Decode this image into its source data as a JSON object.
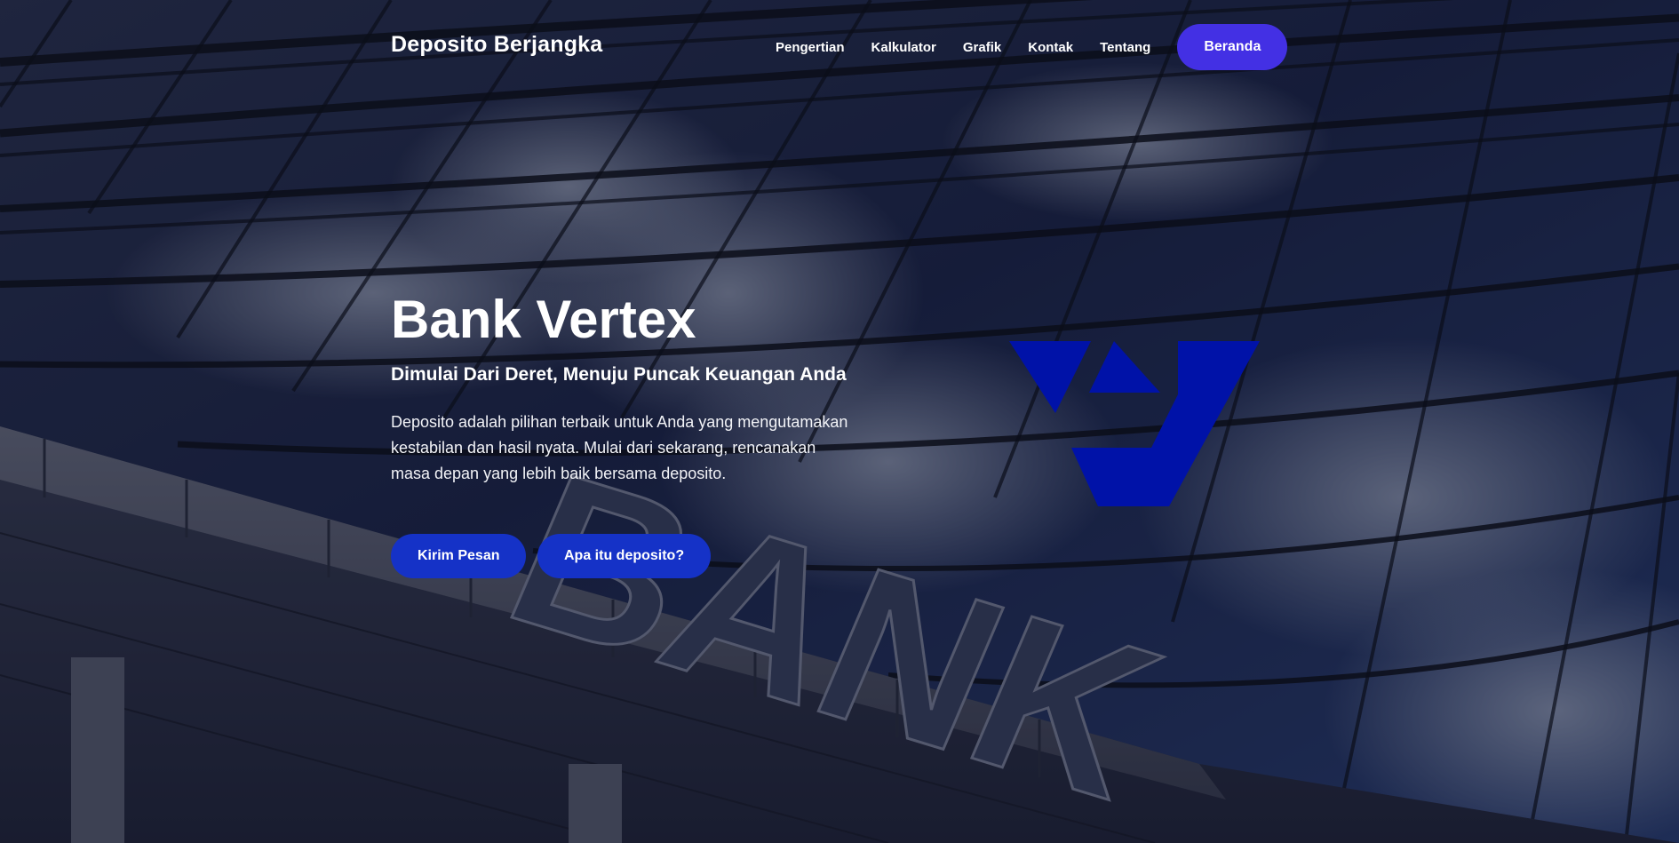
{
  "header": {
    "brand": "Deposito Berjangka",
    "nav": [
      {
        "label": "Pengertian"
      },
      {
        "label": "Kalkulator"
      },
      {
        "label": "Grafik"
      },
      {
        "label": "Kontak"
      },
      {
        "label": "Tentang"
      }
    ],
    "cta_label": "Beranda"
  },
  "hero": {
    "title": "Bank Vertex",
    "subtitle": "Dimulai Dari Deret, Menuju Puncak Keuangan Anda",
    "description": "Deposito adalah pilihan terbaik untuk Anda yang mengutamakan kestabilan dan hasil nyata. Mulai dari sekarang, rencanakan masa depan yang lebih baik bersama deposito.",
    "primary_button": "Kirim Pesan",
    "secondary_button": "Apa itu deposito?",
    "background_sign_text": "BANK"
  },
  "colors": {
    "cta": "#4330e4",
    "button": "#1532c7",
    "logo": "#0012a8",
    "overlay": "#080c1c"
  },
  "icons": {
    "logo": "vertex-v-logo-icon"
  }
}
